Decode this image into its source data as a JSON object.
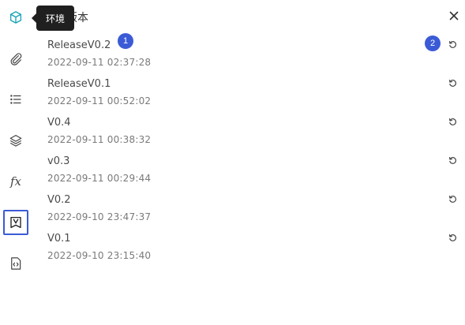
{
  "tooltip": {
    "text": "环境"
  },
  "panel": {
    "title": "版本"
  },
  "versions": [
    {
      "name": "ReleaseV0.2",
      "time": "2022-09-11 02:37:28"
    },
    {
      "name": "ReleaseV0.1",
      "time": "2022-09-11 00:52:02"
    },
    {
      "name": "V0.4",
      "time": "2022-09-11 00:38:32"
    },
    {
      "name": "v0.3",
      "time": "2022-09-11 00:29:44"
    },
    {
      "name": "V0.2",
      "time": "2022-09-10 23:47:37"
    },
    {
      "name": "V0.1",
      "time": "2022-09-10 23:15:40"
    }
  ],
  "annotations": {
    "badge1": "1",
    "badge2": "2"
  },
  "rail": {
    "items": [
      {
        "icon": "cube-icon"
      },
      {
        "icon": "paperclip-icon"
      },
      {
        "icon": "list-icon"
      },
      {
        "icon": "layers-icon"
      },
      {
        "icon": "fx-icon",
        "glyph": "fx"
      },
      {
        "icon": "version-icon",
        "active": true
      },
      {
        "icon": "code-file-icon"
      }
    ]
  },
  "colors": {
    "accent": "#3b5bd6",
    "cube": "#1aa3b8",
    "tooltip_bg": "#1f1f1f"
  }
}
